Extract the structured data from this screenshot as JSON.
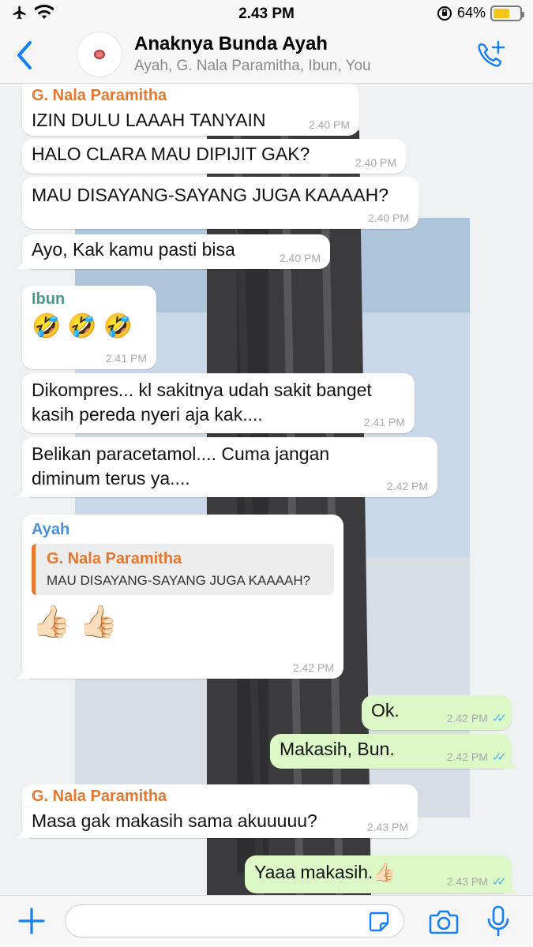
{
  "status_bar": {
    "time": "2.43 PM",
    "battery": "64%",
    "battery_level": 0.64
  },
  "header": {
    "title": "Anaknya Bunda Ayah",
    "subtitle": "Ayah, G. Nala Paramitha, Ibun, You"
  },
  "colors": {
    "accent": "#147efb",
    "outgoing": "#dcf8c6",
    "incoming": "#ffffff",
    "sender_nala": "#e8762d",
    "sender_ibun": "#4a9a8c",
    "sender_ayah": "#4a8fd9",
    "read_ticks": "#4fb6ec"
  },
  "messages": [
    {
      "sender": "G. Nala Paramitha",
      "text": "IZIN DULU LAAAH TANYAIN",
      "time": "2.40 PM"
    },
    {
      "text": "HALO CLARA MAU DIPIJIT GAK?",
      "time": "2.40 PM"
    },
    {
      "text": "MAU DISAYANG-SAYANG JUGA KAAAAH?",
      "time": "2.40 PM"
    },
    {
      "text": "Ayo, Kak kamu pasti bisa",
      "time": "2.40 PM"
    },
    {
      "sender": "Ibun",
      "emoji": "🤣🤣🤣",
      "time": "2.41 PM"
    },
    {
      "text_line1": "Dikompres... kl sakitnya udah sakit banget",
      "text_line2": "kasih pereda nyeri aja kak....",
      "time": "2.41 PM"
    },
    {
      "text_line1": "Belikan paracetamol.... Cuma jangan",
      "text_line2": "diminum terus ya....",
      "time": "2.42 PM"
    },
    {
      "sender": "Ayah",
      "quote_name": "G. Nala Paramitha",
      "quote_text": "MAU DISAYANG-SAYANG JUGA KAAAAH?",
      "emoji": "👍🏻👍🏻",
      "time": "2.42 PM"
    },
    {
      "text": "Ok.",
      "time": "2.42 PM"
    },
    {
      "text": "Makasih, Bun.",
      "time": "2.42 PM"
    },
    {
      "sender": "G. Nala Paramitha",
      "text": "Masa gak makasih sama akuuuuu?",
      "time": "2.43 PM"
    },
    {
      "text": "Yaaa makasih.👍🏻",
      "time": "2.43 PM"
    }
  ],
  "icons": [
    "back-icon",
    "call-add-icon",
    "plus-icon",
    "sticker-icon",
    "camera-icon",
    "mic-icon"
  ]
}
